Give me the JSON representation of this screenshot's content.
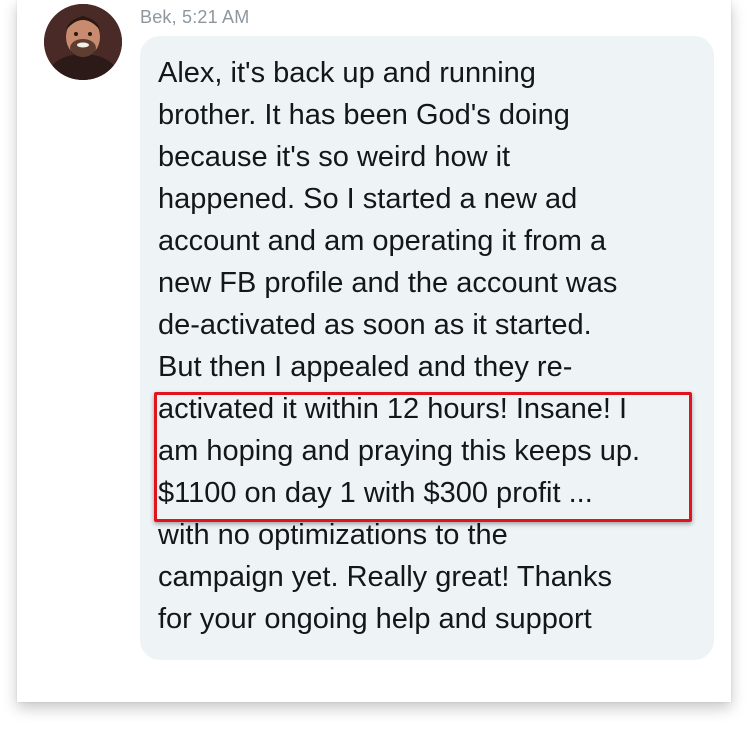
{
  "message": {
    "sender": "Bek",
    "time": "5:21 AM",
    "meta_text": "Bek, 5:21 AM",
    "lines": [
      "Alex, it's back up and running",
      "brother. It has been God's doing",
      "because it's so weird how it",
      "happened. So I started a new ad",
      "account and am operating it from a",
      "new FB profile and the account was",
      "de-activated as soon as it started.",
      "But then I appealed and they re-",
      "activated it within 12 hours! Insane! I",
      "am hoping and praying this keeps up.",
      "$1100 on day 1 with $300 profit ...",
      "with no optimizations to the",
      "campaign yet. Really great! Thanks",
      "for your ongoing help and support"
    ]
  },
  "avatar": {
    "icon": "user-avatar-photo"
  },
  "highlight": {
    "color": "#e0141e"
  },
  "colors": {
    "bubble": "#eef3f6",
    "text": "#14171a",
    "meta": "#8e979e"
  }
}
